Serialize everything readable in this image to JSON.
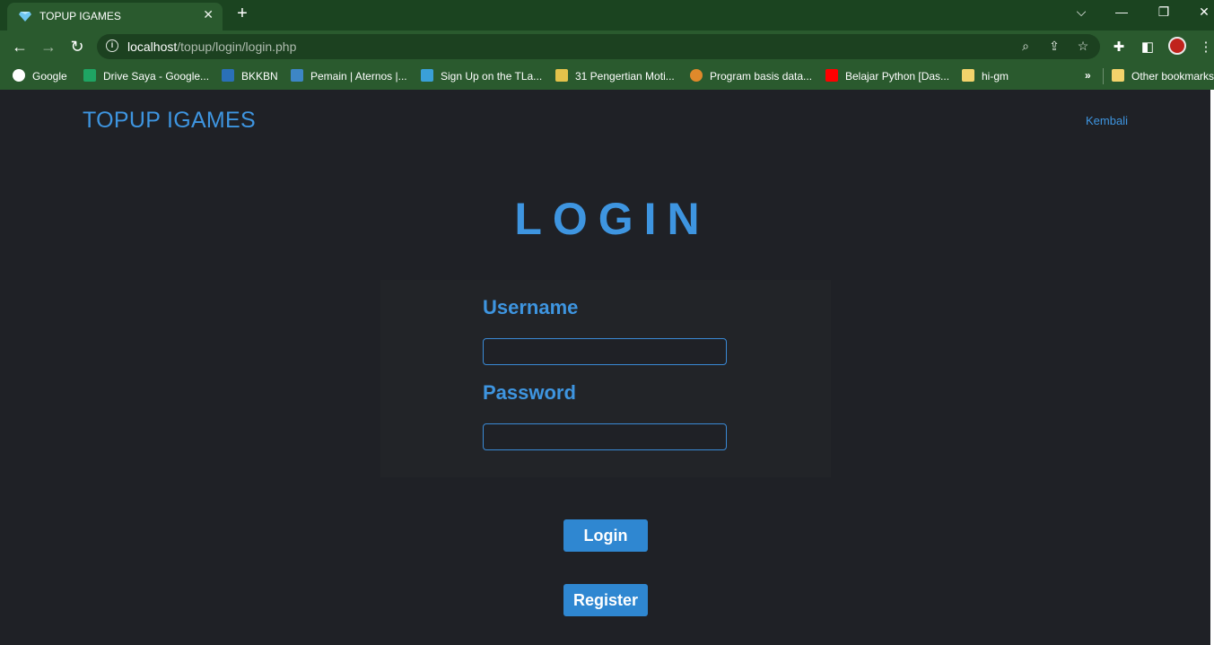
{
  "browser": {
    "tab": {
      "title": "TOPUP IGAMES",
      "favicon": "diamond-icon",
      "close": "✕"
    },
    "new_tab": "+",
    "window_controls": {
      "tabsearch": "⌵",
      "minimize": "—",
      "restore": "❐",
      "close": "✕"
    },
    "nav": {
      "back": "←",
      "forward": "→",
      "reload": "↻"
    },
    "address": {
      "host": "localhost",
      "path": "/topup/login/login.php"
    },
    "omnibox_icons": [
      "zoom-icon",
      "share-icon",
      "star-icon"
    ],
    "toolbar_icons": [
      "extensions-icon",
      "sidepanel-icon",
      "menu-icon"
    ],
    "bookmarks": [
      {
        "label": "Google",
        "icon": "google-icon",
        "color": "#ffffff"
      },
      {
        "label": "Drive Saya - Google...",
        "icon": "drive-icon",
        "color": "#1fa463"
      },
      {
        "label": "BKKBN",
        "icon": "bkkbn-icon",
        "color": "#2a70b8"
      },
      {
        "label": "Pemain | Aternos |...",
        "icon": "aternos-icon",
        "color": "#3d86c6"
      },
      {
        "label": "Sign Up on the TLa...",
        "icon": "tl-icon",
        "color": "#3aa0d8"
      },
      {
        "label": "31 Pengertian Moti...",
        "icon": "motivation-icon",
        "color": "#e3c24b"
      },
      {
        "label": "Program basis data...",
        "icon": "circle-icon",
        "color": "#e0892b"
      },
      {
        "label": "Belajar Python [Das...",
        "icon": "youtube-icon",
        "color": "#ff0000"
      },
      {
        "label": "hi-gm",
        "icon": "folder-icon",
        "color": "#f3d36b"
      }
    ],
    "bookmarks_more": "»",
    "other_bookmarks": "Other bookmarks"
  },
  "page": {
    "brand": "TOPUP IGAMES",
    "back_link": "Kembali",
    "title": "LOGIN",
    "username_label": "Username",
    "username_value": "",
    "password_label": "Password",
    "password_value": "",
    "login_button": "Login",
    "register_button": "Register"
  },
  "colors": {
    "accent": "#3e95e0",
    "button": "#2f87d1",
    "background": "#1f2126",
    "chrome": "#2a5a2e"
  }
}
